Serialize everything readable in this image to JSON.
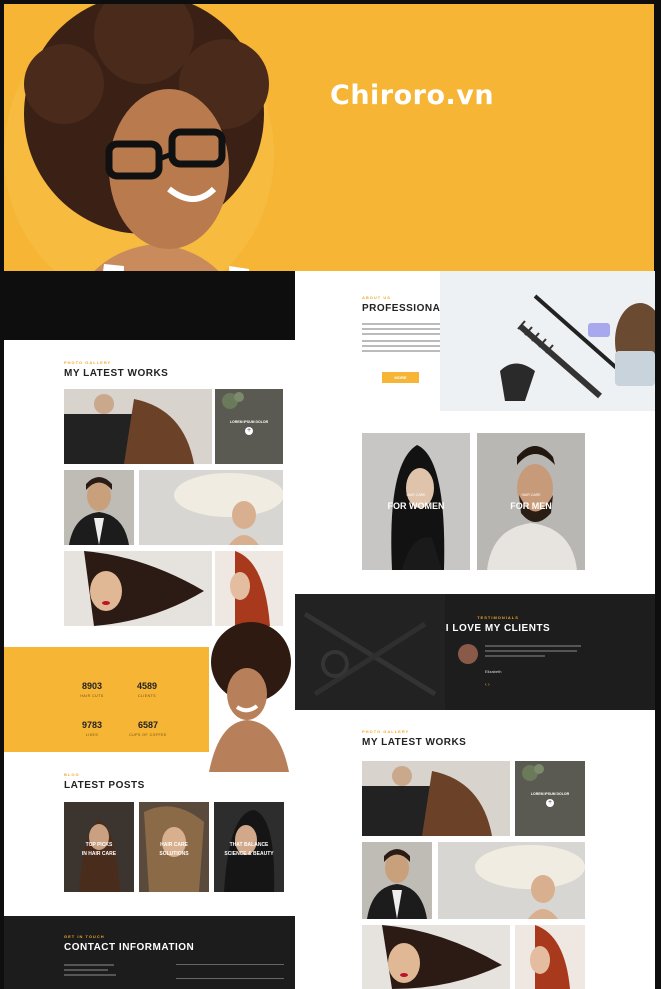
{
  "brand": "Chiroro.vn",
  "about": {
    "kicker": "ABOUT US",
    "title": "PROFESSIONAL HAIR STYLIST",
    "button": "MORE"
  },
  "works": {
    "kicker": "PHOTO GALLERY",
    "title": "MY LATEST WORKS",
    "hover_caption": "LOREM IPSUM DOLOR"
  },
  "categories": [
    {
      "small": "HAIR CARE",
      "label": "FOR WOMEN"
    },
    {
      "small": "HAIR CARE",
      "label": "FOR MEN"
    }
  ],
  "testimonials": {
    "kicker": "TESTIMONIALS",
    "title": "I LOVE MY CLIENTS",
    "author": "Elizabeth"
  },
  "stats": [
    {
      "value": "8903",
      "label": "HAIR CUTS"
    },
    {
      "value": "4589",
      "label": "CLIENTS"
    },
    {
      "value": "9783",
      "label": "LIKES"
    },
    {
      "value": "6587",
      "label": "CUPS OF COFFEE"
    }
  ],
  "posts": {
    "kicker": "BLOG",
    "title": "LATEST POSTS",
    "items": [
      {
        "line1": "TOP PICKS",
        "line2": "IN HAIR CARE"
      },
      {
        "line1": "HAIR CARE",
        "line2": "SOLUTIONS"
      },
      {
        "line1": "THAT BALANCE",
        "line2": "SCIENCE & BEAUTY"
      }
    ]
  },
  "contact": {
    "kicker": "GET IN TOUCH",
    "title": "CONTACT INFORMATION"
  },
  "colors": {
    "accent": "#f6b534",
    "dark": "#1e1e1e",
    "text": "#222222"
  }
}
